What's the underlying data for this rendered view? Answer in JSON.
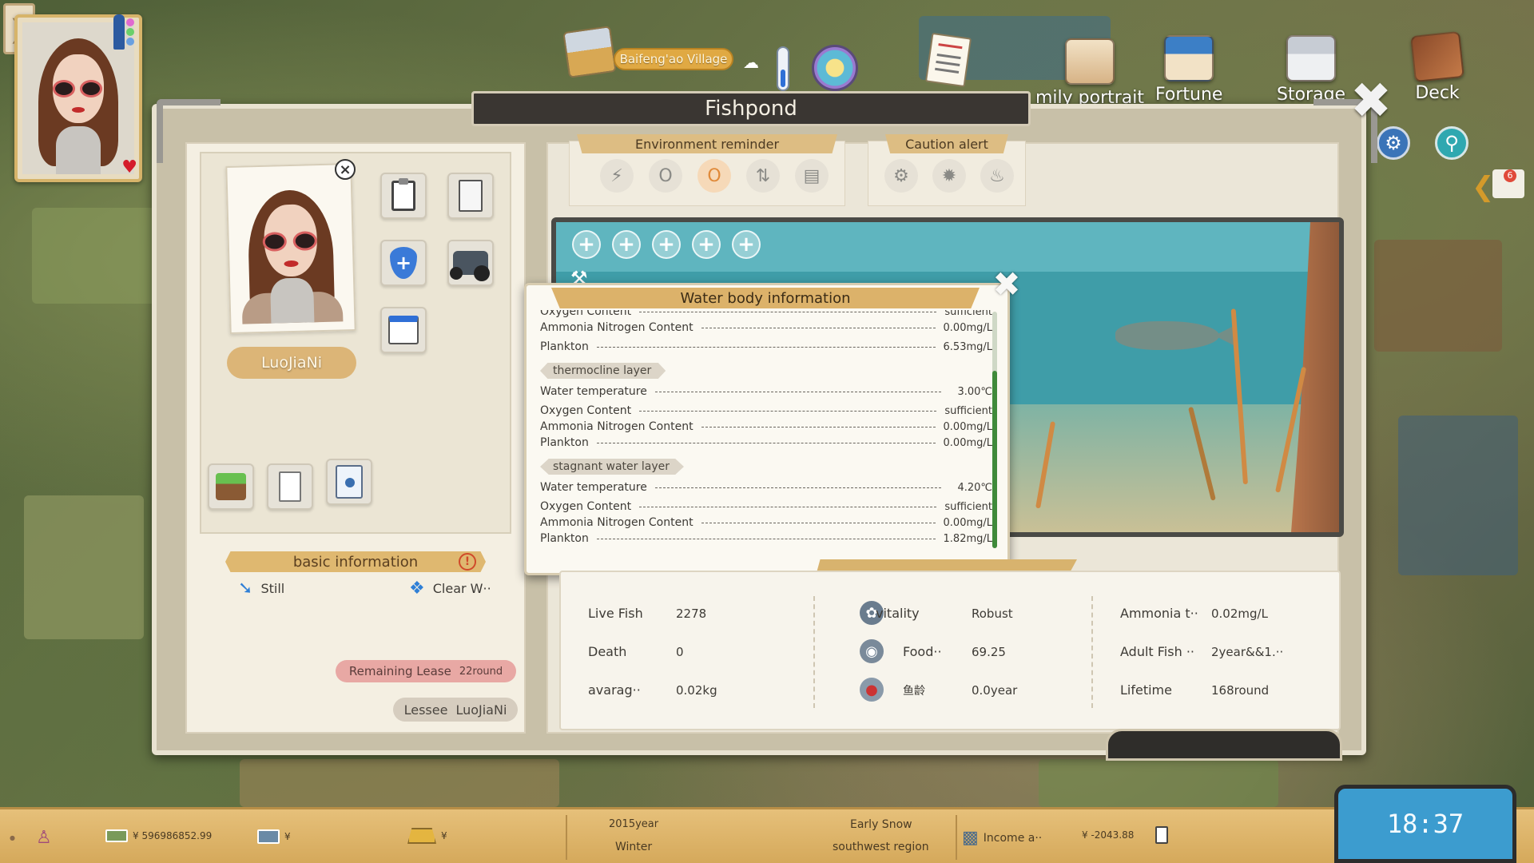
{
  "village": {
    "name": "Baifeng'ao Village"
  },
  "top_menu": [
    {
      "label": "mily portrait",
      "icon": "family-portrait-icon"
    },
    {
      "label": "Fortune",
      "icon": "fortune-icon"
    },
    {
      "label": "Storage",
      "icon": "storage-icon"
    },
    {
      "label": "Deck",
      "icon": "deck-icon"
    }
  ],
  "window": {
    "title": "Fishpond"
  },
  "player": {
    "name": "LuoJiaNi"
  },
  "basic_info": {
    "title": "basic information",
    "status_left": "Still",
    "status_right": "Clear W··",
    "remaining_lease_label": "Remaining Lease",
    "remaining_lease_value": "22round",
    "lessee_label": "Lessee",
    "lessee_value": "LuoJiaNi"
  },
  "environment_reminder": {
    "title": "Environment reminder"
  },
  "caution_alert": {
    "title": "Caution alert"
  },
  "water_body": {
    "title": "Water body information",
    "top_rows": [
      {
        "key": "Oxygen Content",
        "value": "sufficient"
      },
      {
        "key": "Ammonia Nitrogen Content",
        "value": "0.00mg/L"
      },
      {
        "key": "Plankton",
        "value": "6.53mg/L"
      }
    ],
    "layers": [
      {
        "name": "thermocline layer",
        "rows": [
          {
            "key": "Water temperature",
            "value": "3.00℃"
          },
          {
            "key": "Oxygen Content",
            "value": "sufficient"
          },
          {
            "key": "Ammonia Nitrogen Content",
            "value": "0.00mg/L"
          },
          {
            "key": "Plankton",
            "value": "0.00mg/L"
          }
        ]
      },
      {
        "name": "stagnant water layer",
        "rows": [
          {
            "key": "Water temperature",
            "value": "4.20℃"
          },
          {
            "key": "Oxygen Content",
            "value": "sufficient"
          },
          {
            "key": "Ammonia Nitrogen Content",
            "value": "0.00mg/L"
          },
          {
            "key": "Plankton",
            "value": "1.82mg/L"
          }
        ]
      }
    ]
  },
  "stats": {
    "live_fish_label": "Live Fish",
    "live_fish": "2278",
    "death_label": "Death",
    "death": "0",
    "average_label": "avarag··",
    "average": "0.02kg",
    "vitality_label": "vitality",
    "vitality": "Robust",
    "food_label": "Food··",
    "food": "69.25",
    "age_label": "鱼龄",
    "age": "0.0year",
    "ammonia_label": "Ammonia t··",
    "ammonia": "0.02mg/L",
    "adult_fish_label": "Adult Fish ··",
    "adult_fish": "2year&&1.··",
    "lifetime_label": "Lifetime",
    "lifetime": "168round"
  },
  "bottom_bar": {
    "money": "¥ 596986852.99",
    "currency2": "¥",
    "currency3": "¥",
    "year": "2015year",
    "season": "Winter",
    "weather": "Early Snow",
    "region": "southwest region",
    "income_label": "Income a··",
    "income_value": "¥ -2043.88",
    "clock": "18:37"
  },
  "notification_badge": "6",
  "colors": {
    "accent_gold": "#dcb26a",
    "panel": "#f4efe2",
    "pond_water": "#3f9da8",
    "clock_blue": "#3c9ccf"
  }
}
